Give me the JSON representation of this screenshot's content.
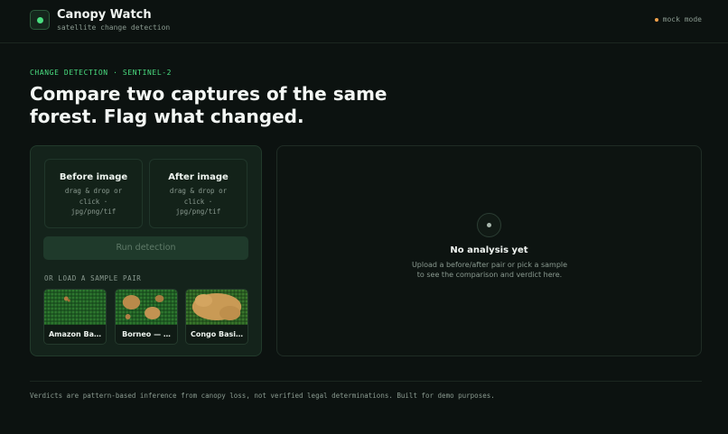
{
  "app": {
    "title": "Canopy Watch",
    "subtitle": "satellite change detection",
    "mode_label": "mock mode",
    "accent": "#4ade80",
    "mode_dot_color": "#f0a04b"
  },
  "hero": {
    "eyebrow": "CHANGE DETECTION · SENTINEL-2",
    "headline": "Compare two captures of the same forest. Flag what changed."
  },
  "upload": {
    "before": {
      "title": "Before image",
      "hint": "drag & drop or click · jpg/png/tif"
    },
    "after": {
      "title": "After image",
      "hint": "drag & drop or click · jpg/png/tif"
    },
    "run_label": "Run detection"
  },
  "samples": {
    "label": "OR LOAD A SAMPLE PAIR",
    "items": [
      {
        "name": "Amazon Ba…"
      },
      {
        "name": "Borneo — …"
      },
      {
        "name": "Congo Basi…"
      }
    ]
  },
  "result": {
    "empty_title": "No analysis yet",
    "empty_text": "Upload a before/after pair or pick a sample to see the comparison and verdict here."
  },
  "footer": {
    "text": "Verdicts are pattern-based inference from canopy loss, not verified legal determinations. Built for demo purposes."
  }
}
